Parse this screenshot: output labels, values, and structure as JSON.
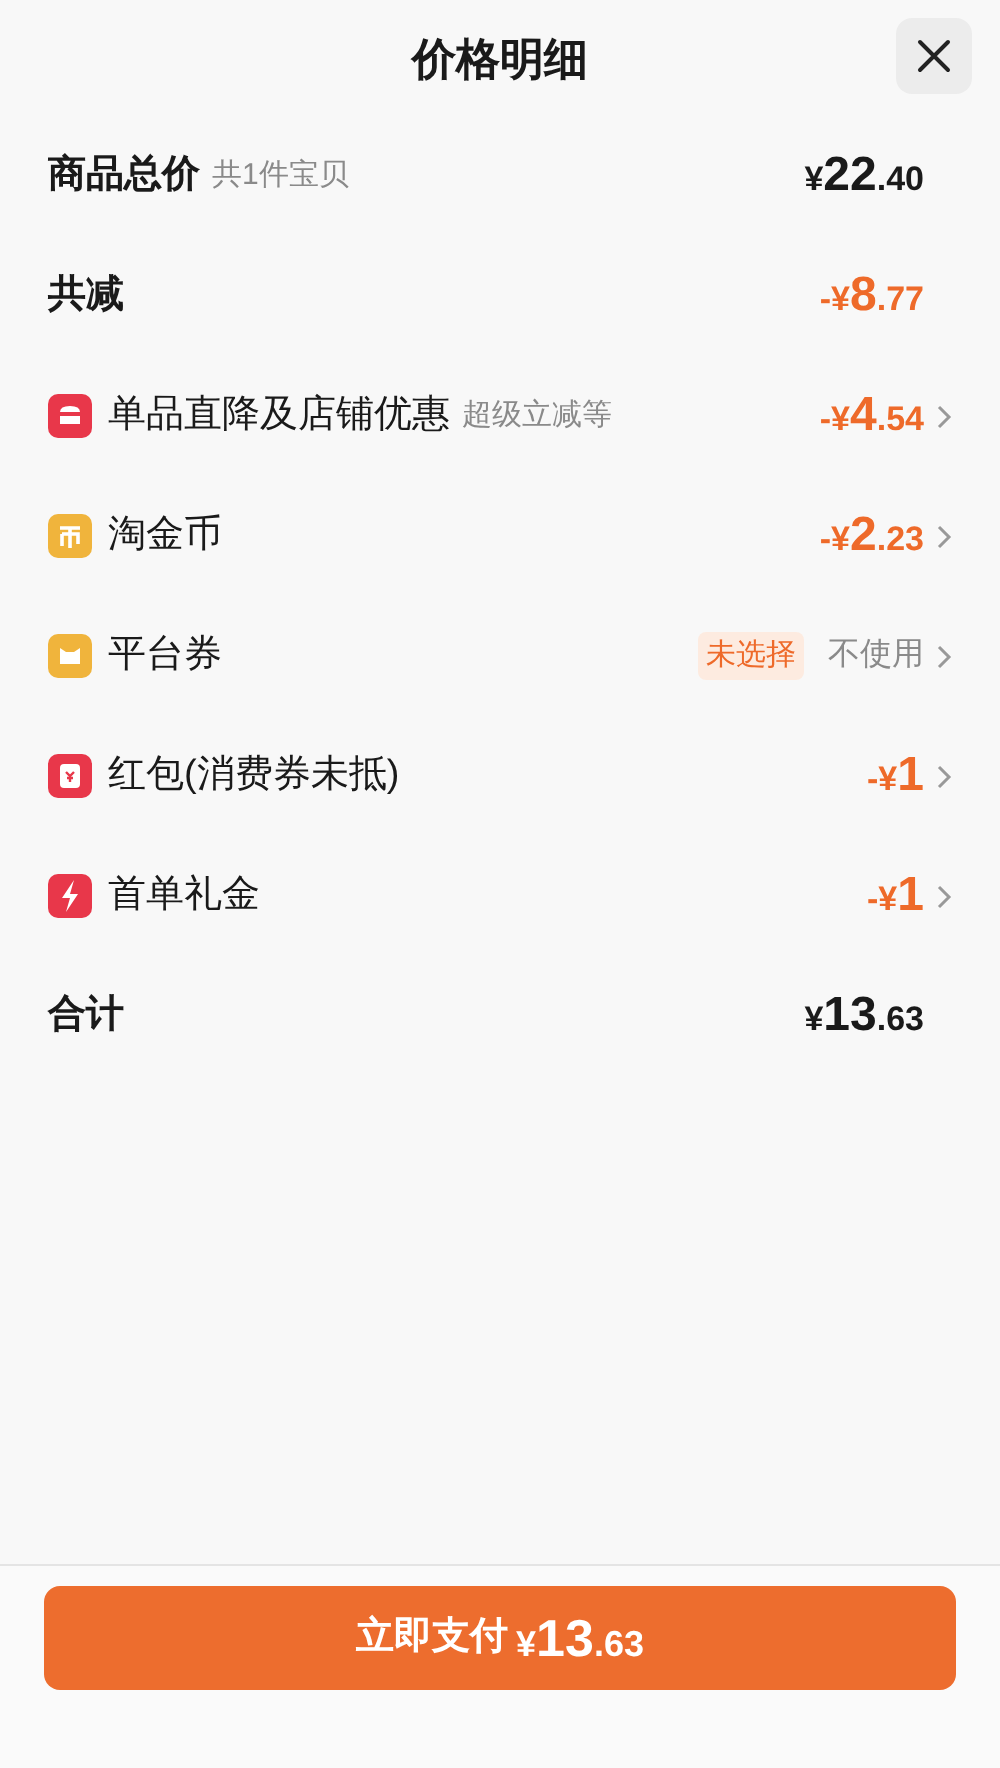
{
  "header": {
    "title": "价格明细"
  },
  "rows": [
    {
      "kind": "total",
      "label": "商品总价",
      "note": "共1件宝贝",
      "price": {
        "sign": "¥",
        "int": "22",
        "dec": ".40"
      }
    },
    {
      "kind": "discount_total",
      "label": "共减",
      "price": {
        "sign": "-¥",
        "int": "8",
        "dec": ".77"
      }
    },
    {
      "kind": "discount",
      "color": "#e8374a",
      "label": "单品直降及店铺优惠",
      "note": "超级立减等",
      "price": {
        "sign": "-¥",
        "int": "4",
        "dec": ".54"
      }
    },
    {
      "kind": "discount",
      "color": "#f0b43c",
      "label": "淘金币",
      "price": {
        "sign": "-¥",
        "int": "2",
        "dec": ".23"
      }
    },
    {
      "kind": "option",
      "color": "#f0b43c",
      "label": "平台券",
      "badge": "未选择",
      "value": "不使用"
    },
    {
      "kind": "discount",
      "color": "#e8374a",
      "label": "红包(消费券未抵)",
      "price": {
        "sign": "-¥",
        "int": "1"
      }
    },
    {
      "kind": "discount",
      "color": "#e8374a",
      "label": "首单礼金",
      "price": {
        "sign": "-¥",
        "int": "1"
      }
    },
    {
      "kind": "sum",
      "label": "合计",
      "price": {
        "sign": "¥",
        "int": "13",
        "dec": ".63"
      }
    }
  ],
  "pay_button": {
    "label": "立即支付",
    "price": {
      "sign": "¥",
      "int": "13",
      "dec": ".63"
    }
  }
}
